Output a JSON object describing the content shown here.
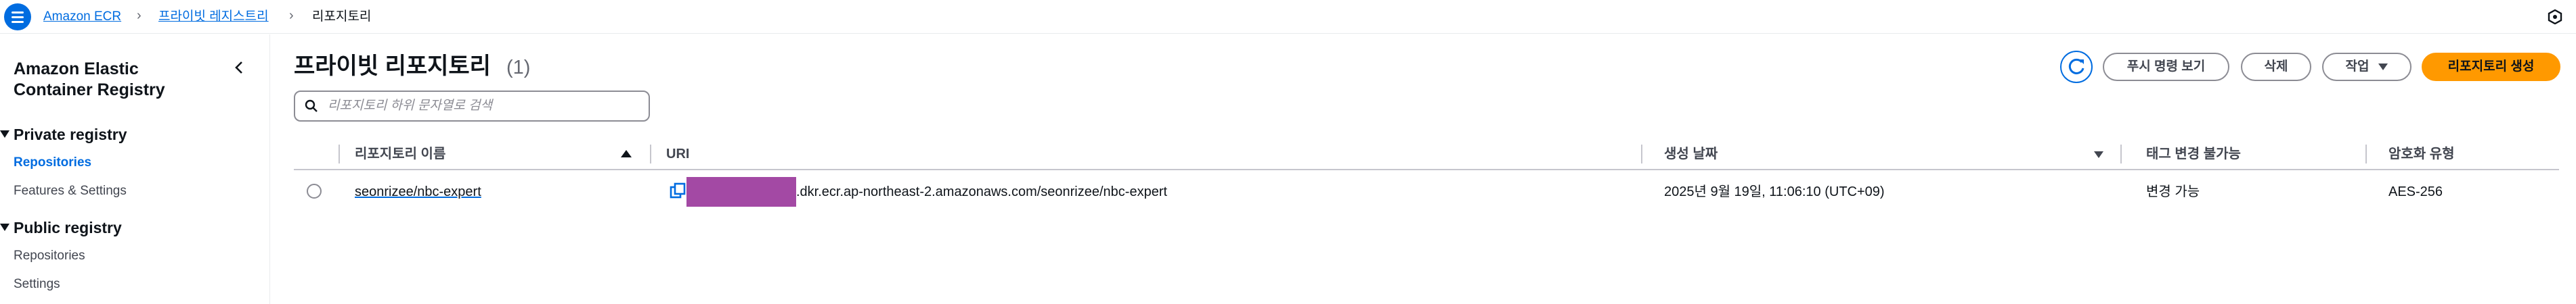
{
  "breadcrumb": {
    "items": [
      {
        "label": "Amazon ECR",
        "link": true
      },
      {
        "label": "프라이빗 레지스트리",
        "link": true
      },
      {
        "label": "리포지토리",
        "link": false
      }
    ]
  },
  "top_right_icon": "cloudshell-hexagon-icon",
  "sidebar": {
    "title": "Amazon Elastic Container Registry",
    "groups": [
      {
        "label": "Private registry",
        "items": [
          {
            "label": "Repositories",
            "active": true
          },
          {
            "label": "Features & Settings",
            "active": false
          }
        ]
      },
      {
        "label": "Public registry",
        "items": [
          {
            "label": "Repositories",
            "active": false
          },
          {
            "label": "Settings",
            "active": false
          }
        ]
      }
    ]
  },
  "header": {
    "title": "프라이빗 리포지토리",
    "count": "(1)",
    "buttons": {
      "push_commands": "푸시 명령 보기",
      "delete": "삭제",
      "actions": "작업",
      "create": "리포지토리 생성"
    }
  },
  "search": {
    "placeholder": "리포지토리 하위 문자열로 검색",
    "value": ""
  },
  "table": {
    "columns": {
      "name": "리포지토리 이름",
      "uri": "URI",
      "created": "생성 날짜",
      "tag_immutability": "태그 변경 불가능",
      "encryption": "암호화 유형"
    },
    "rows": [
      {
        "name": "seonrizee/nbc-expert",
        "uri_suffix": ".dkr.ecr.ap-northeast-2.amazonaws.com/seonrizee/nbc-expert",
        "created": "2025년 9월 19일, 11:06:10 (UTC+09)",
        "tag_immutability": "변경 가능",
        "encryption": "AES-256"
      }
    ]
  },
  "colors": {
    "link_blue": "#006ce0",
    "primary_orange": "#ff9900",
    "redaction_purple": "#a349a4",
    "border_gray": "#8c8c94"
  }
}
